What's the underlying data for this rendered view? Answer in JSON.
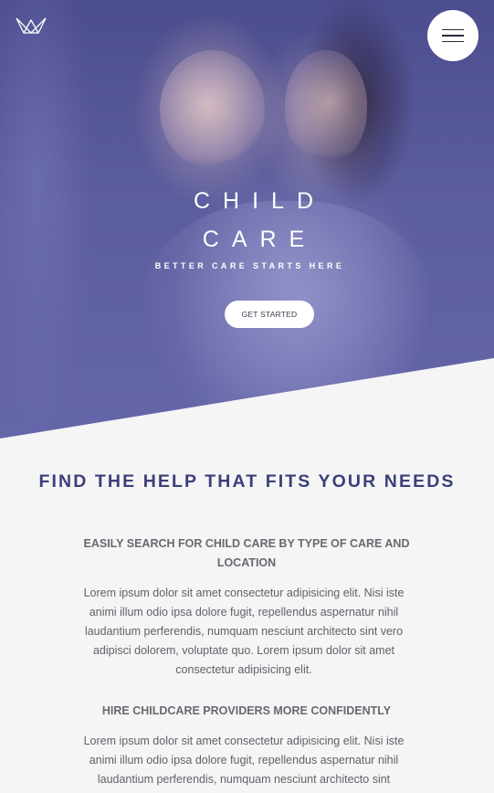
{
  "hero": {
    "title_line1": "CHILD",
    "title_line2": "CARE",
    "tagline": "BETTER CARE STARTS HERE",
    "cta_label": "GET STARTED",
    "overlay_color": "#5c5d9e"
  },
  "nav": {
    "logo_icon": "crown-icon",
    "menu_icon": "hamburger-menu-icon"
  },
  "main": {
    "heading": "FIND THE HELP THAT FITS YOUR NEEDS",
    "heading_color": "#3b4079",
    "blocks": [
      {
        "title": "EASILY SEARCH FOR CHILD CARE BY TYPE OF CARE AND LOCATION",
        "text": "Lorem ipsum dolor sit amet consectetur adipisicing elit. Nisi iste animi illum odio ipsa dolore fugit, repellendus aspernatur nihil laudantium perferendis, numquam nesciunt architecto sint vero adipisci dolorem, voluptate quo. Lorem ipsum dolor sit amet consectetur adipisicing elit."
      },
      {
        "title": "HIRE CHILDCARE PROVIDERS MORE CONFIDENTLY",
        "text": "Lorem ipsum dolor sit amet consectetur adipisicing elit. Nisi iste animi illum odio ipsa dolore fugit, repellendus aspernatur nihil laudantium perferendis, numquam nesciunt architecto sint"
      }
    ]
  }
}
